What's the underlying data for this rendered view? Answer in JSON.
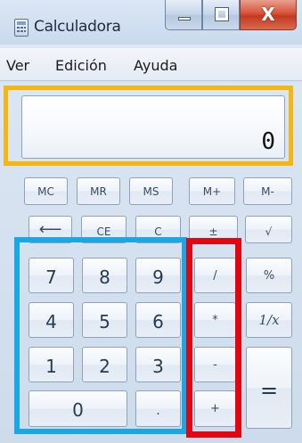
{
  "window": {
    "title": "Calculadora",
    "close_glyph": "X"
  },
  "menu": [
    "Ver",
    "Edición",
    "Ayuda"
  ],
  "display": {
    "value": "0"
  },
  "keys": {
    "mc": "MC",
    "mr": "MR",
    "ms": "MS",
    "mplus": "M+",
    "mminus": "M-",
    "back": "⟵",
    "ce": "CE",
    "c": "C",
    "plusminus": "±",
    "sqrt": "√",
    "n7": "7",
    "n8": "8",
    "n9": "9",
    "div": "/",
    "pct": "%",
    "n4": "4",
    "n5": "5",
    "n6": "6",
    "mul": "*",
    "recip": "1/x",
    "n1": "1",
    "n2": "2",
    "n3": "3",
    "sub": "-",
    "eq": "=",
    "n0": "0",
    "dot": ".",
    "add": "+"
  },
  "colors": {
    "highlight_display": "#f5b70f",
    "highlight_digits": "#1aa7e6",
    "highlight_operators": "#e3050f"
  },
  "icons": {
    "app": "calculator-icon",
    "minimize": "minimize-icon",
    "maximize": "maximize-icon",
    "close": "close-icon"
  }
}
